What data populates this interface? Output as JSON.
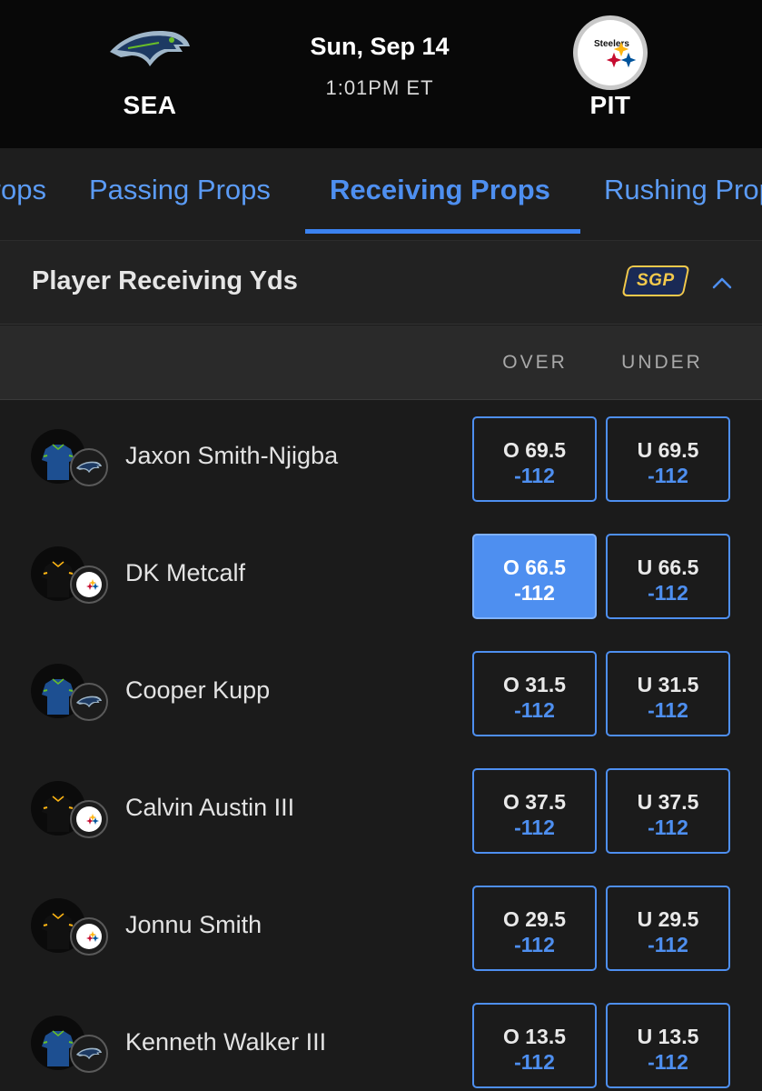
{
  "game": {
    "away": {
      "abbr": "SEA",
      "logo": "seahawks-logo"
    },
    "home": {
      "abbr": "PIT",
      "logo": "steelers-logo",
      "logo_text": "Steelers"
    },
    "date": "Sun, Sep 14",
    "time": "1:01PM ET"
  },
  "tabs": [
    {
      "label": "Props",
      "active": false
    },
    {
      "label": "Passing Props",
      "active": false
    },
    {
      "label": "Receiving Props",
      "active": true
    },
    {
      "label": "Rushing Props",
      "active": false
    }
  ],
  "market": {
    "title": "Player Receiving Yds",
    "badge": "SGP",
    "collapse_icon": "chevron-up-icon",
    "columns": {
      "over": "OVER",
      "under": "UNDER"
    }
  },
  "players": [
    {
      "name": "Jaxon Smith-Njigba",
      "team": "SEA",
      "over_line": "O 69.5",
      "over_price": "-112",
      "under_line": "U 69.5",
      "under_price": "-112",
      "over_selected": false
    },
    {
      "name": "DK Metcalf",
      "team": "PIT",
      "over_line": "O 66.5",
      "over_price": "-112",
      "under_line": "U 66.5",
      "under_price": "-112",
      "over_selected": true
    },
    {
      "name": "Cooper Kupp",
      "team": "SEA",
      "over_line": "O 31.5",
      "over_price": "-112",
      "under_line": "U 31.5",
      "under_price": "-112",
      "over_selected": false
    },
    {
      "name": "Calvin Austin III",
      "team": "PIT",
      "over_line": "O 37.5",
      "over_price": "-112",
      "under_line": "U 37.5",
      "under_price": "-112",
      "over_selected": false
    },
    {
      "name": "Jonnu Smith",
      "team": "PIT",
      "over_line": "O 29.5",
      "over_price": "-112",
      "under_line": "U 29.5",
      "under_price": "-112",
      "over_selected": false
    },
    {
      "name": "Kenneth Walker III",
      "team": "SEA",
      "over_line": "O 13.5",
      "over_price": "-112",
      "under_line": "U 13.5",
      "under_price": "-112",
      "over_selected": false
    }
  ],
  "colors": {
    "accent": "#4e8ff0",
    "background": "#1b1b1b",
    "header": "#080808",
    "sgp": "#f2c94c"
  }
}
